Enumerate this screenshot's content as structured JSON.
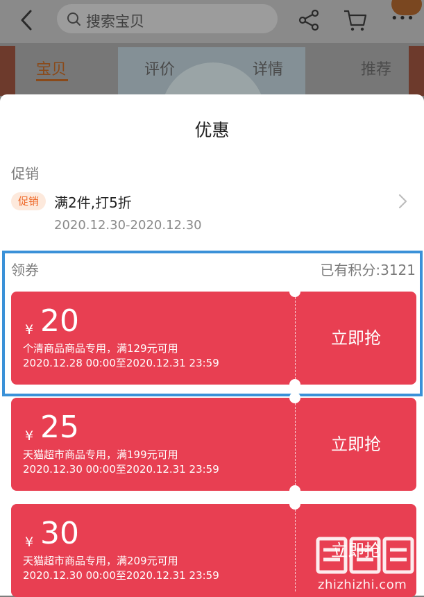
{
  "header": {
    "search_placeholder": "搜索宝贝",
    "tabs": [
      {
        "label": "宝贝",
        "active": true
      },
      {
        "label": "评价",
        "active": false
      },
      {
        "label": "详情",
        "active": false
      },
      {
        "label": "推荐",
        "active": false
      }
    ],
    "icons": [
      "back-arrow-icon",
      "search-icon",
      "share-icon",
      "cart-icon",
      "more-icon"
    ]
  },
  "sheet": {
    "title": "优惠",
    "promotion": {
      "section_label": "促销",
      "badge": "促销",
      "title": "满2件,打5折",
      "date_range": "2020.12.30-2020.12.30"
    },
    "coupons_section": {
      "label": "领券",
      "points": "已有积分:3121",
      "coupons": [
        {
          "currency": "¥",
          "amount": "20",
          "condition": "个清商品商品专用，满129元可用",
          "validity": "2020.12.28 00:00至2020.12.31 23:59",
          "action": "立即抢"
        },
        {
          "currency": "¥",
          "amount": "25",
          "condition": "天猫超市商品专用，满199元可用",
          "validity": "2020.12.30 00:00至2020.12.31 23:59",
          "action": "立即抢"
        },
        {
          "currency": "¥",
          "amount": "30",
          "condition": "天猫超市商品专用，满209元可用",
          "validity": "2020.12.30 00:00至2020.12.31 23:59",
          "action": "立即抢"
        }
      ]
    }
  },
  "watermark": {
    "logo_text": "值",
    "site": "zhizhizhi.com"
  },
  "colors": {
    "coupon_red": "#e83f52",
    "highlight_blue": "#3a91d8",
    "promo_orange": "#ee6a2a"
  }
}
